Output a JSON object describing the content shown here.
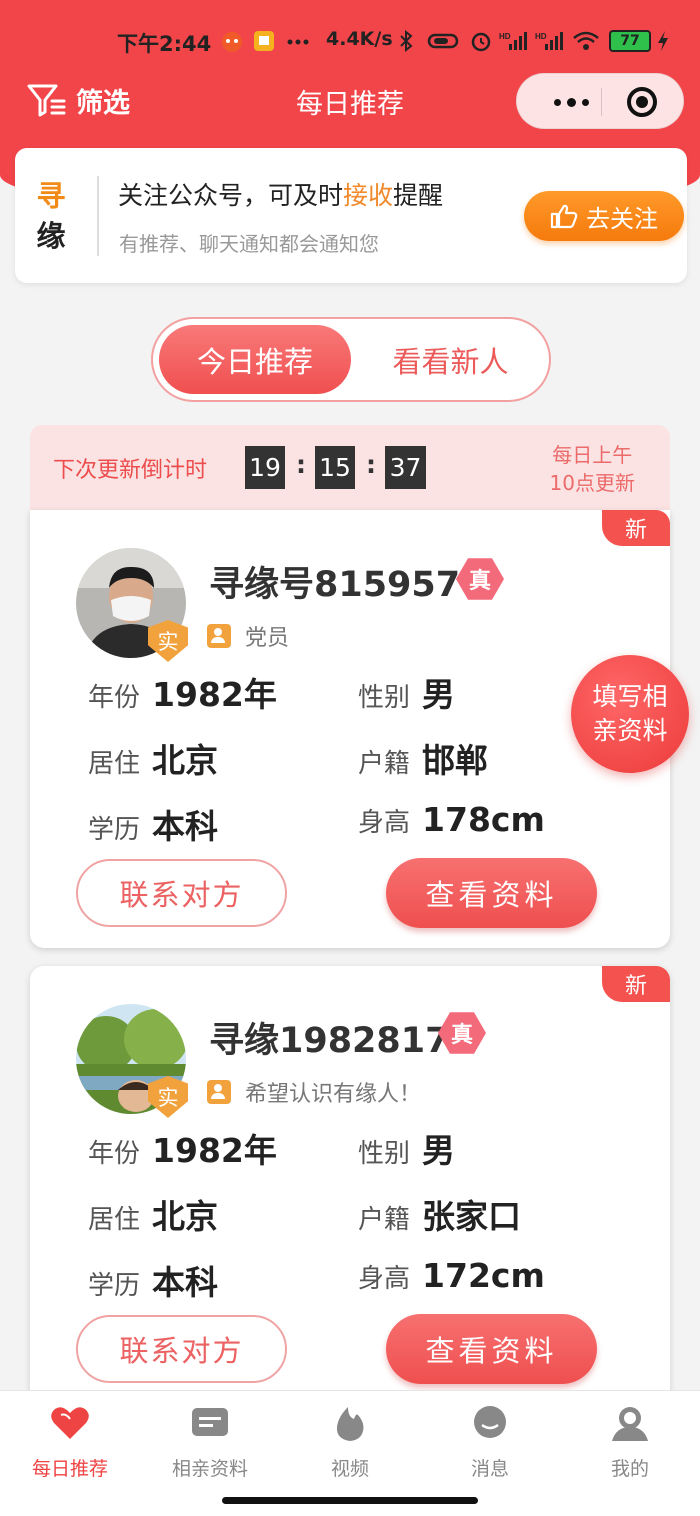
{
  "status": {
    "time": "下午2:44",
    "speed": "4.4K/s",
    "battery": "77"
  },
  "nav": {
    "filter_label": "筛选",
    "title": "每日推荐"
  },
  "notice": {
    "logo_1": "寻",
    "logo_2": "缘",
    "title_pre": "关注公众号，可及时",
    "title_hl": "接收",
    "title_post": "提醒",
    "subtitle": "有推荐、聊天通知都会通知您",
    "button": "去关注"
  },
  "tabs": {
    "active": "今日推荐",
    "other": "看看新人"
  },
  "countdown": {
    "label": "下次更新倒计时",
    "h": "19",
    "m": "15",
    "s": "37",
    "note_1": "每日上午",
    "note_2": "10点更新"
  },
  "fab": "填写相亲资料",
  "profiles": [
    {
      "badge_new": "新",
      "name": "寻缘号815957",
      "verified": "真",
      "real": "实",
      "tagline": "党员",
      "year_label": "年份",
      "year": "1982年",
      "gender_label": "性别",
      "gender": "男",
      "city_label": "居住",
      "city": "北京",
      "hukou_label": "户籍",
      "hukou": "邯郸",
      "edu_label": "学历",
      "edu": "本科",
      "height_label": "身高",
      "height": "178cm",
      "contact": "联系对方",
      "view": "查看资料"
    },
    {
      "badge_new": "新",
      "name": "寻缘1982817",
      "verified": "真",
      "real": "实",
      "tagline": "希望认识有缘人！",
      "year_label": "年份",
      "year": "1982年",
      "gender_label": "性别",
      "gender": "男",
      "city_label": "居住",
      "city": "北京",
      "hukou_label": "户籍",
      "hukou": "张家口",
      "edu_label": "学历",
      "edu": "本科",
      "height_label": "身高",
      "height": "172cm",
      "contact": "联系对方",
      "view": "查看资料"
    }
  ],
  "tabbar": [
    {
      "label": "每日推荐",
      "icon": "hearts-icon",
      "active": true
    },
    {
      "label": "相亲资料",
      "icon": "profile-card-icon",
      "active": false
    },
    {
      "label": "视频",
      "icon": "flame-icon",
      "active": false
    },
    {
      "label": "消息",
      "icon": "chat-icon",
      "active": false
    },
    {
      "label": "我的",
      "icon": "user-icon",
      "active": false
    }
  ],
  "colors": {
    "brand": "#f2454a",
    "accent": "#f57a0c",
    "verified": "#f36a7a",
    "badge": "#f2a23c"
  }
}
